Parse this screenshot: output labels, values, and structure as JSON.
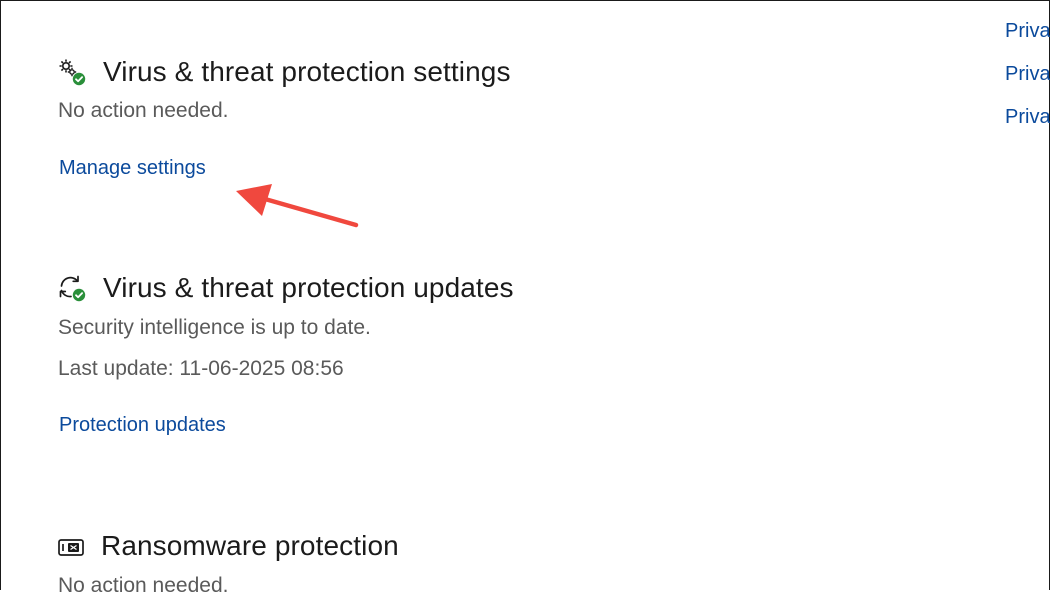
{
  "sections": [
    {
      "title": "Virus & threat protection settings",
      "description": "No action needed.",
      "link": "Manage settings",
      "icon": "gear-check-icon"
    },
    {
      "title": "Virus & threat protection updates",
      "description": "Security intelligence is up to date.",
      "detail": "Last update: 11-06-2025 08:56",
      "link": "Protection updates",
      "icon": "sync-check-icon"
    },
    {
      "title": "Ransomware protection",
      "description": "No action needed.",
      "icon": "ransomware-shield-icon"
    }
  ],
  "privacy_links": [
    "Priva",
    "Priva",
    "Priva"
  ],
  "colors": {
    "link": "#0b4a9c",
    "title": "#1b1b1b",
    "description": "#5a5a5a",
    "check_green": "#2a8f3a",
    "annotation_arrow": "#f0483e"
  }
}
